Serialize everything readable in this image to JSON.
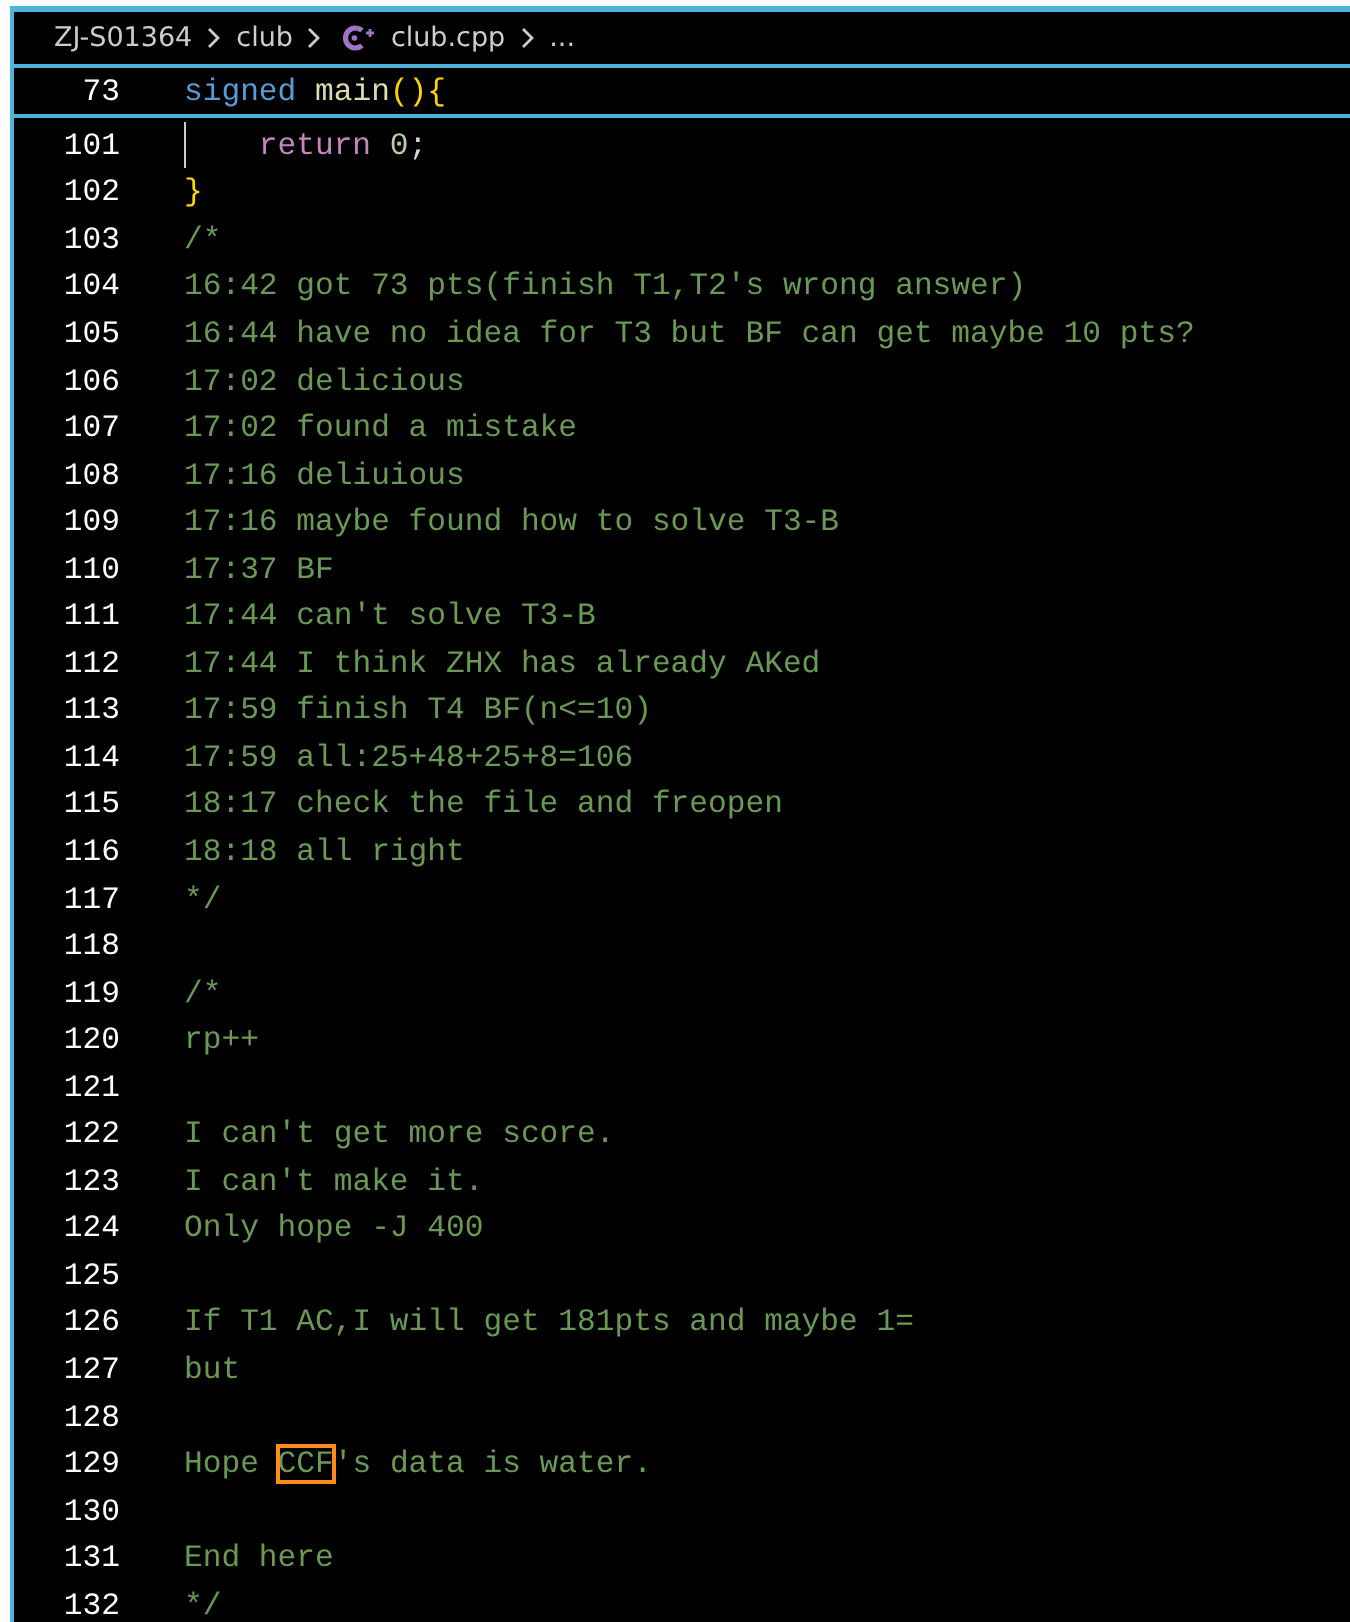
{
  "breadcrumb": [
    {
      "kind": "folder",
      "label": "ZJ-S01364"
    },
    {
      "kind": "folder",
      "label": "club"
    },
    {
      "kind": "cpp-file",
      "label": "club.cpp"
    },
    {
      "kind": "more",
      "label": "..."
    }
  ],
  "sticky_line": {
    "number": "73",
    "tokens": [
      {
        "kind": "keyword",
        "text": "signed "
      },
      {
        "kind": "function",
        "text": "main"
      },
      {
        "kind": "bracket",
        "text": "(){"
      }
    ]
  },
  "lines": [
    {
      "number": "101",
      "indent_guide": true,
      "tokens": [
        {
          "kind": "control",
          "text": "return "
        },
        {
          "kind": "number",
          "text": "0"
        },
        {
          "kind": "plain",
          "text": ";"
        }
      ]
    },
    {
      "number": "102",
      "tokens": [
        {
          "kind": "bracket",
          "text": "}"
        }
      ]
    },
    {
      "number": "103",
      "tokens": [
        {
          "kind": "comment",
          "text": "/*"
        }
      ]
    },
    {
      "number": "104",
      "tokens": [
        {
          "kind": "comment",
          "text": "16:42 got 73 pts(finish T1,T2's wrong answer)"
        }
      ]
    },
    {
      "number": "105",
      "tokens": [
        {
          "kind": "comment",
          "text": "16:44 have no idea for T3 but BF can get maybe 10 pts?"
        }
      ]
    },
    {
      "number": "106",
      "tokens": [
        {
          "kind": "comment",
          "text": "17:02 delicious"
        }
      ]
    },
    {
      "number": "107",
      "tokens": [
        {
          "kind": "comment",
          "text": "17:02 found a mistake"
        }
      ]
    },
    {
      "number": "108",
      "tokens": [
        {
          "kind": "comment",
          "text": "17:16 deliuious"
        }
      ]
    },
    {
      "number": "109",
      "tokens": [
        {
          "kind": "comment",
          "text": "17:16 maybe found how to solve T3-B"
        }
      ]
    },
    {
      "number": "110",
      "tokens": [
        {
          "kind": "comment",
          "text": "17:37 BF"
        }
      ]
    },
    {
      "number": "111",
      "tokens": [
        {
          "kind": "comment",
          "text": "17:44 can't solve T3-B"
        }
      ]
    },
    {
      "number": "112",
      "tokens": [
        {
          "kind": "comment",
          "text": "17:44 I think ZHX has already AKed"
        }
      ]
    },
    {
      "number": "113",
      "tokens": [
        {
          "kind": "comment",
          "text": "17:59 finish T4 BF(n<=10)"
        }
      ]
    },
    {
      "number": "114",
      "tokens": [
        {
          "kind": "comment",
          "text": "17:59 all:25+48+25+8=106"
        }
      ]
    },
    {
      "number": "115",
      "tokens": [
        {
          "kind": "comment",
          "text": "18:17 check the file and freopen"
        }
      ]
    },
    {
      "number": "116",
      "tokens": [
        {
          "kind": "comment",
          "text": "18:18 all right"
        }
      ]
    },
    {
      "number": "117",
      "tokens": [
        {
          "kind": "comment",
          "text": "*/"
        }
      ]
    },
    {
      "number": "118"
    },
    {
      "number": "119",
      "tokens": [
        {
          "kind": "comment",
          "text": "/*"
        }
      ]
    },
    {
      "number": "120",
      "tokens": [
        {
          "kind": "comment",
          "text": "rp++"
        }
      ]
    },
    {
      "number": "121"
    },
    {
      "number": "122",
      "tokens": [
        {
          "kind": "comment",
          "text": "I can't get more score."
        }
      ]
    },
    {
      "number": "123",
      "tokens": [
        {
          "kind": "comment",
          "text": "I can't make it."
        }
      ]
    },
    {
      "number": "124",
      "tokens": [
        {
          "kind": "comment",
          "text": "Only hope -J 400"
        }
      ]
    },
    {
      "number": "125"
    },
    {
      "number": "126",
      "tokens": [
        {
          "kind": "comment",
          "text": "If T1 AC,I will get 181pts and maybe 1="
        }
      ]
    },
    {
      "number": "127",
      "tokens": [
        {
          "kind": "comment",
          "text": "but"
        }
      ]
    },
    {
      "number": "128"
    },
    {
      "number": "129",
      "tokens": [
        {
          "kind": "comment",
          "text": "Hope "
        },
        {
          "kind": "comment",
          "text": "CCF",
          "highlighted": true
        },
        {
          "kind": "comment",
          "text": "'s data is water."
        }
      ]
    },
    {
      "number": "130"
    },
    {
      "number": "131",
      "tokens": [
        {
          "kind": "comment",
          "text": "End here"
        }
      ]
    },
    {
      "number": "132",
      "tokens": [
        {
          "kind": "comment",
          "text": "*/"
        }
      ]
    }
  ]
}
